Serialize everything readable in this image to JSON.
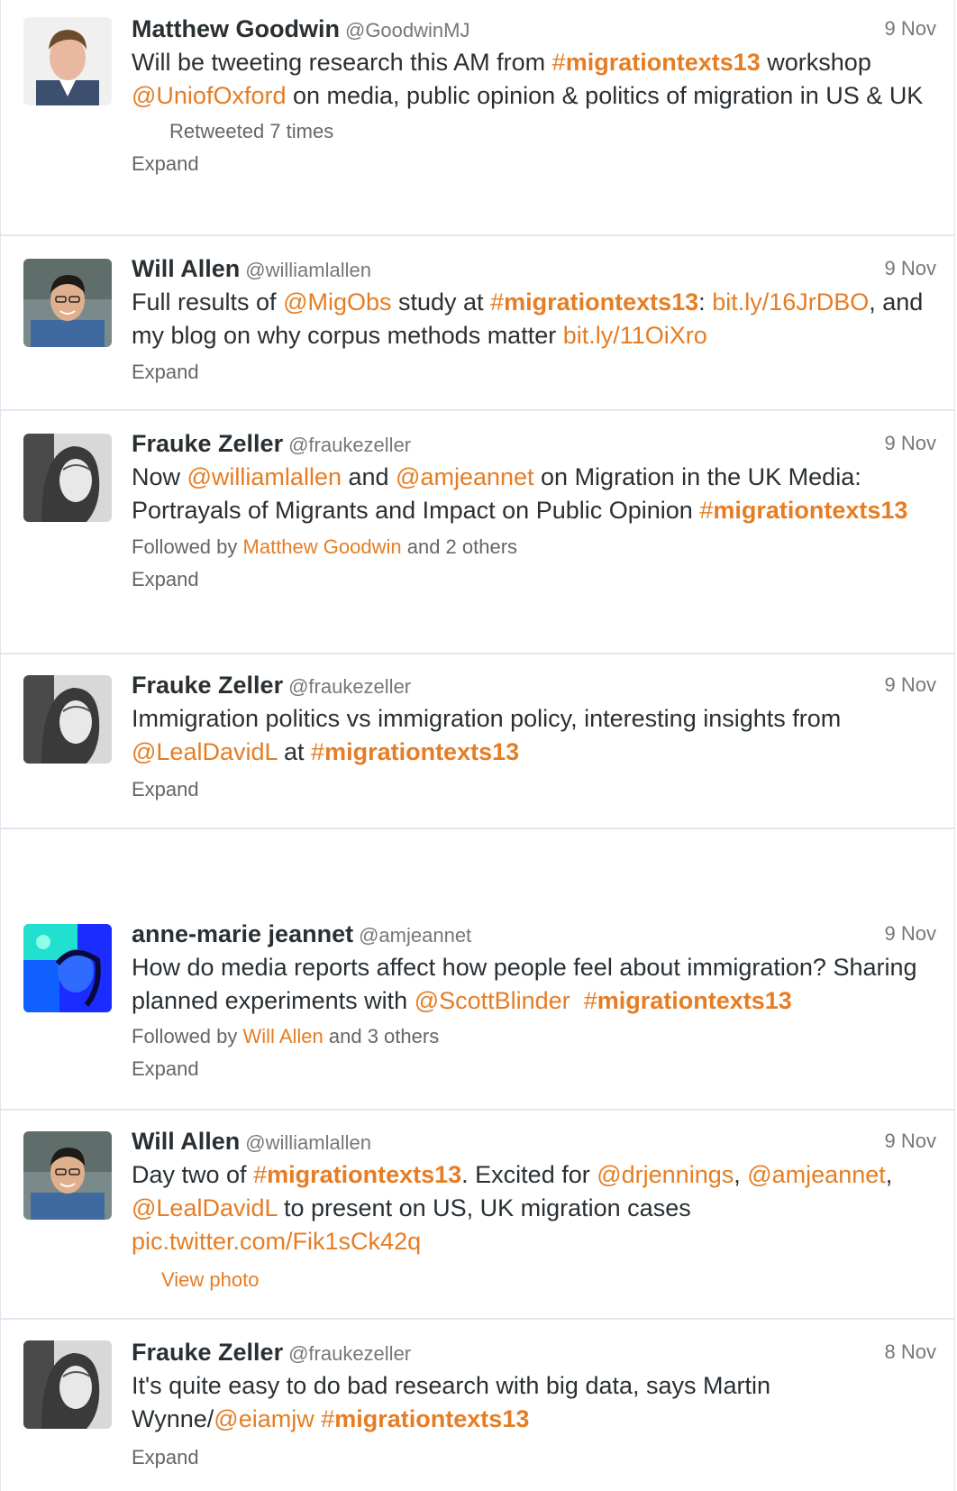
{
  "colors": {
    "accent": "#e57d24",
    "text": "#292f33",
    "muted": "#777777",
    "border": "#e1e8ed"
  },
  "tweets": [
    {
      "name": "Matthew Goodwin",
      "handle": "@GoodwinMJ",
      "time": "9 Nov",
      "t": [
        "Will be tweeting research this AM from ",
        "#",
        "migrationtexts13",
        " workshop ",
        "@UniofOxford",
        " on media, public opinion & politics of migration in US & UK"
      ],
      "retweeted": "Retweeted 7 times",
      "expand": "Expand"
    },
    {
      "name": "Will Allen",
      "handle": "@williamlallen",
      "time": "9 Nov",
      "t": [
        "Full results of ",
        "@MigObs",
        " study at ",
        "#",
        "migrationtexts13",
        ": ",
        "bit.ly/16JrDBO",
        ", and my blog on why corpus methods matter ",
        "bit.ly/11OiXro"
      ],
      "expand": "Expand"
    },
    {
      "name": "Frauke Zeller",
      "handle": "@fraukezeller",
      "time": "9 Nov",
      "t": [
        "Now ",
        "@williamlallen",
        " and ",
        "@amjeannet",
        " on Migration in the UK Media: Portrayals of Migrants and Impact on Public Opinion ",
        "#",
        "migrationtexts13"
      ],
      "followed": [
        "Followed by ",
        "Matthew Goodwin",
        " and 2 others"
      ],
      "expand": "Expand"
    },
    {
      "name": "Frauke Zeller",
      "handle": "@fraukezeller",
      "time": "9 Nov",
      "t": [
        "Immigration politics vs immigration policy, interesting insights from ",
        "@LealDavidL",
        " at ",
        "#",
        "migrationtexts13"
      ],
      "expand": "Expand"
    },
    {
      "name": "anne-marie jeannet",
      "handle": "@amjeannet",
      "time": "9 Nov",
      "t": [
        "How do media reports affect how people feel about immigration? Sharing planned experiments with ",
        "@ScottBlinder",
        "  ",
        "#",
        "migrationtexts13"
      ],
      "followed": [
        "Followed by ",
        "Will Allen",
        " and 3 others"
      ],
      "expand": "Expand"
    },
    {
      "name": "Will Allen",
      "handle": "@williamlallen",
      "time": "9 Nov",
      "t": [
        "Day two of ",
        "#",
        "migrationtexts13",
        ". Excited for ",
        "@drjennings",
        ", ",
        "@amjeannet",
        ", ",
        "@LealDavidL",
        " to present on US, UK migration cases ",
        "pic.twitter.com/Fik1sCk42q"
      ],
      "view_photo": "View photo"
    },
    {
      "name": "Frauke Zeller",
      "handle": "@fraukezeller",
      "time": "8 Nov",
      "t": [
        "It's quite easy to do bad research with big data, says Martin Wynne/",
        "@eiamjw",
        " ",
        "#",
        "migrationtexts13"
      ],
      "expand": "Expand"
    }
  ]
}
